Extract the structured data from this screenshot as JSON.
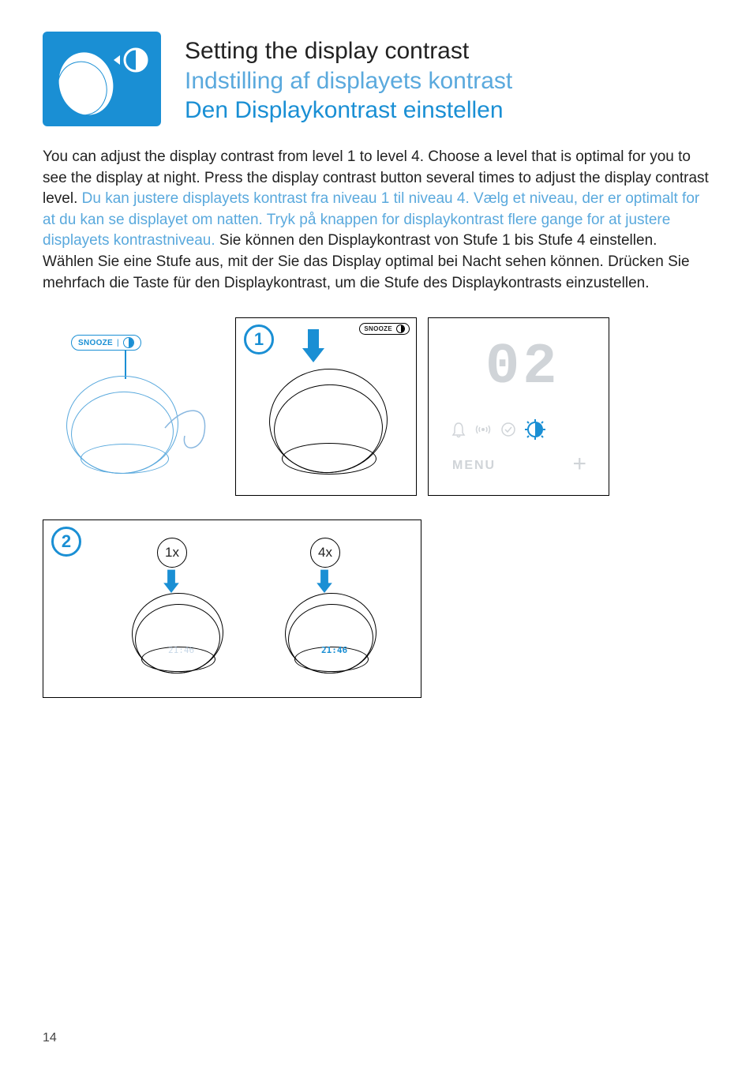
{
  "titles": {
    "en": "Setting the display contrast",
    "da": "Indstilling af displayets kontrast",
    "de": "Den Displaykontrast einstellen"
  },
  "body": {
    "en": "You can adjust the display contrast from level 1 to level 4. Choose a level that is optimal for you to see the display at night. Press the display contrast button several times to adjust the display contrast level.",
    "da": "Du kan justere displayets kontrast fra niveau 1 til niveau 4. Vælg et niveau, der er optimalt for at du kan se displayet om natten. Tryk på knappen for displaykontrast flere gange for at justere displayets kontrastniveau.",
    "de": "Sie können den Displaykontrast von Stufe 1 bis Stufe 4 einstellen. Wählen Sie eine Stufe aus, mit der Sie das Display optimal bei Nacht sehen können. Drücken Sie mehrfach die Taste für den Displaykontrast, um die Stufe des Displaykontrasts einzustellen."
  },
  "labels": {
    "snooze": "SNOOZE",
    "menu": "MENU",
    "plus": "+",
    "step1": "1",
    "step2": "2",
    "press1x": "1x",
    "press4x": "4x",
    "display_value": "02",
    "tiny_time": "21:46"
  },
  "page_number": "14"
}
